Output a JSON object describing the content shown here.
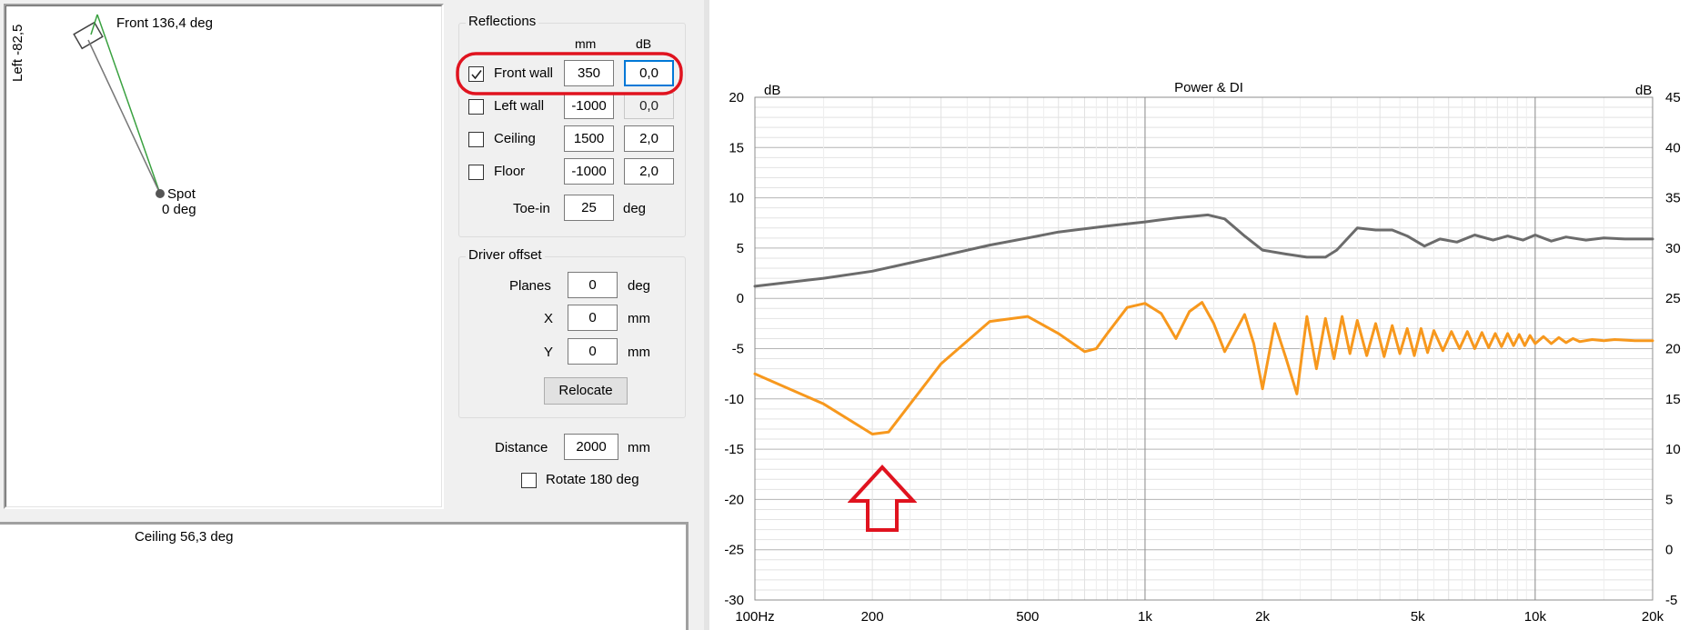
{
  "plan": {
    "front_label": "Front 136,4 deg",
    "left_label": "Left -82,5",
    "spot_label": "Spot",
    "spot_deg": "0 deg"
  },
  "side": {
    "ceiling_label": "Ceiling 56,3 deg"
  },
  "reflections": {
    "title": "Reflections",
    "col_mm": "mm",
    "col_db": "dB",
    "rows": [
      {
        "label": "Front wall",
        "checked": true,
        "mm": "350",
        "db": "0,0"
      },
      {
        "label": "Left wall",
        "checked": false,
        "mm": "-1000",
        "db": "0,0"
      },
      {
        "label": "Ceiling",
        "checked": false,
        "mm": "1500",
        "db": "2,0"
      },
      {
        "label": "Floor",
        "checked": false,
        "mm": "-1000",
        "db": "2,0"
      }
    ],
    "toein_label": "Toe-in",
    "toein_value": "25",
    "toein_unit": "deg"
  },
  "driver_offset": {
    "title": "Driver offset",
    "planes_label": "Planes",
    "planes_value": "0",
    "planes_unit": "deg",
    "x_label": "X",
    "x_value": "0",
    "x_unit": "mm",
    "y_label": "Y",
    "y_value": "0",
    "y_unit": "mm",
    "relocate_label": "Relocate"
  },
  "distance": {
    "label": "Distance",
    "value": "2000",
    "unit": "mm"
  },
  "rotate": {
    "label": "Rotate 180 deg",
    "checked": false
  },
  "colors": {
    "annotation_red": "#e0131f",
    "power_orange": "#f7981d",
    "di_gray": "#6b6b6b",
    "focus_blue": "#0078d7"
  },
  "chart_data": {
    "type": "line",
    "title": "Power & DI",
    "ylabel_left": "dB",
    "ylabel_right": "dB",
    "x_scale": "log",
    "xlim": [
      100,
      20000
    ],
    "ylim_left": [
      -30,
      20
    ],
    "ylim_right": [
      -5,
      45
    ],
    "x_tick_labels": [
      "100Hz",
      "200",
      "500",
      "1k",
      "2k",
      "5k",
      "10k",
      "20k"
    ],
    "x_ticks": [
      100,
      200,
      500,
      1000,
      2000,
      5000,
      10000,
      20000
    ],
    "y_left_ticks": [
      20,
      15,
      10,
      5,
      0,
      -5,
      -10,
      -15,
      -20,
      -25,
      -30
    ],
    "y_right_ticks": [
      45,
      40,
      35,
      30,
      25,
      20,
      15,
      10,
      5,
      0,
      -5
    ],
    "grid": true,
    "series": [
      {
        "axis": "left",
        "color": "#6b6b6b",
        "x": [
          100,
          150,
          200,
          300,
          400,
          500,
          600,
          800,
          1000,
          1200,
          1450,
          1600,
          1800,
          2000,
          2300,
          2600,
          2900,
          3100,
          3500,
          3900,
          4300,
          4700,
          5200,
          5700,
          6300,
          7000,
          7800,
          8500,
          9300,
          10000,
          11000,
          12000,
          13500,
          15000,
          17000,
          20000
        ],
        "y": [
          1.2,
          2.0,
          2.7,
          4.2,
          5.3,
          6.0,
          6.6,
          7.2,
          7.6,
          8.0,
          8.3,
          7.9,
          6.2,
          4.8,
          4.4,
          4.1,
          4.1,
          4.8,
          7.0,
          6.8,
          6.8,
          6.2,
          5.2,
          5.9,
          5.6,
          6.3,
          5.8,
          6.2,
          5.8,
          6.3,
          5.7,
          6.1,
          5.8,
          6.0,
          5.9,
          5.9
        ]
      },
      {
        "axis": "left",
        "color": "#f7981d",
        "x": [
          100,
          150,
          200,
          220,
          300,
          400,
          500,
          600,
          700,
          750,
          800,
          900,
          1000,
          1100,
          1200,
          1300,
          1400,
          1500,
          1600,
          1800,
          1900,
          2000,
          2150,
          2300,
          2450,
          2600,
          2750,
          2900,
          3050,
          3200,
          3350,
          3500,
          3700,
          3900,
          4100,
          4300,
          4500,
          4700,
          4900,
          5100,
          5300,
          5500,
          5800,
          6100,
          6400,
          6700,
          7000,
          7300,
          7600,
          7900,
          8200,
          8500,
          8800,
          9100,
          9400,
          9700,
          10000,
          10500,
          11000,
          11500,
          12000,
          12500,
          13000,
          14000,
          15000,
          16000,
          18000,
          20000
        ],
        "y": [
          -7.5,
          -10.5,
          -13.5,
          -13.3,
          -6.5,
          -2.3,
          -1.8,
          -3.5,
          -5.3,
          -5.0,
          -3.5,
          -0.9,
          -0.5,
          -1.5,
          -4.0,
          -1.3,
          -0.4,
          -2.5,
          -5.3,
          -1.6,
          -4.5,
          -9.0,
          -2.5,
          -6.0,
          -9.5,
          -1.8,
          -7.0,
          -2.0,
          -6.0,
          -1.8,
          -5.5,
          -2.2,
          -5.7,
          -2.5,
          -5.8,
          -2.7,
          -5.5,
          -3.0,
          -5.7,
          -3.0,
          -5.4,
          -3.2,
          -5.2,
          -3.3,
          -5.0,
          -3.3,
          -5.0,
          -3.4,
          -4.9,
          -3.5,
          -4.8,
          -3.5,
          -4.7,
          -3.6,
          -4.7,
          -3.7,
          -4.5,
          -3.8,
          -4.5,
          -3.9,
          -4.4,
          -4.0,
          -4.3,
          -4.1,
          -4.2,
          -4.1,
          -4.2,
          -4.2
        ]
      }
    ]
  }
}
